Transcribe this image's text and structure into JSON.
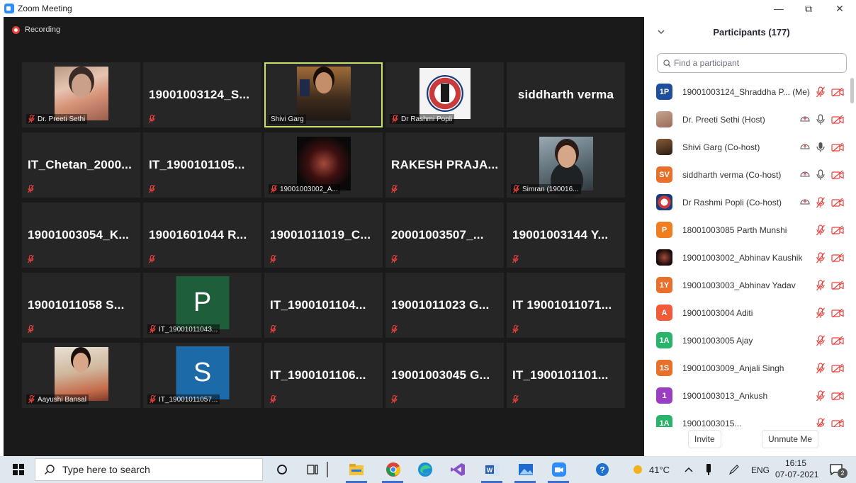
{
  "window": {
    "title": "Zoom Meeting",
    "minimize": "—",
    "restore": "⧉",
    "close": "✕"
  },
  "recording": {
    "label": "Recording"
  },
  "tiles": [
    {
      "type": "photo",
      "photo": "preeti",
      "label": "Dr. Preeti Sethi"
    },
    {
      "type": "name",
      "name": "19001003124_S...",
      "label": ""
    },
    {
      "type": "photo",
      "photo": "shivi",
      "label": "Shivi Garg",
      "active": true,
      "nomic": true
    },
    {
      "type": "photo",
      "photo": "logo",
      "label": "Dr Rashmi Popli"
    },
    {
      "type": "name",
      "name": "siddharth verma",
      "center": true,
      "nomic": true,
      "label": ""
    },
    {
      "type": "name",
      "name": "IT_Chetan_2000...",
      "label": ""
    },
    {
      "type": "name",
      "name": "IT_1900101105...",
      "label": ""
    },
    {
      "type": "photo",
      "photo": "abhinav",
      "label": "19001003002_A..."
    },
    {
      "type": "name",
      "name": "RAKESH PRAJA...",
      "label": ""
    },
    {
      "type": "photo",
      "photo": "simran",
      "label": "Simran (190016..."
    },
    {
      "type": "name",
      "name": "19001003054_K...",
      "label": ""
    },
    {
      "type": "name",
      "name": "19001601044 R...",
      "label": ""
    },
    {
      "type": "name",
      "name": "19001011019_C...",
      "label": ""
    },
    {
      "type": "name",
      "name": "20001003507_...",
      "label": ""
    },
    {
      "type": "name",
      "name": "19001003144 Y...",
      "label": ""
    },
    {
      "type": "name",
      "name": "19001011058 S...",
      "label": ""
    },
    {
      "type": "avatar",
      "letter": "P",
      "color": "#1e5e3a",
      "label": "IT_19001011043..."
    },
    {
      "type": "name",
      "name": "IT_1900101104...",
      "label": ""
    },
    {
      "type": "name",
      "name": "19001011023 G...",
      "label": ""
    },
    {
      "type": "name",
      "name": "IT 19001011071...",
      "label": ""
    },
    {
      "type": "photo",
      "photo": "aayushi",
      "label": "Aayushi Bansal"
    },
    {
      "type": "avatar",
      "letter": "S",
      "color": "#1c6aa8",
      "label": "IT_19001011057..."
    },
    {
      "type": "name",
      "name": "IT_1900101106...",
      "label": ""
    },
    {
      "type": "name",
      "name": "19001003045 G...",
      "label": ""
    },
    {
      "type": "name",
      "name": "IT_1900101101...",
      "label": ""
    }
  ],
  "panel": {
    "title": "Participants (177)",
    "collapse_icon": "chevron-down-icon",
    "search_placeholder": "Find a participant",
    "participants": [
      {
        "initials": "1P",
        "color": "#1d4f9c",
        "name": "19001003124_Shraddha P... (Me)",
        "audio": "muted",
        "video": "off"
      },
      {
        "initials": "",
        "img": "img1",
        "name": "Dr. Preeti Sethi (Host)",
        "share": true,
        "audio": "on",
        "video": "off"
      },
      {
        "initials": "",
        "img": "img2",
        "name": "Shivi Garg (Co-host)",
        "share": true,
        "audio": "active",
        "video": "off"
      },
      {
        "initials": "SV",
        "color": "#e8702a",
        "name": "siddharth verma (Co-host)",
        "share": true,
        "audio": "on",
        "video": "off"
      },
      {
        "initials": "",
        "img": "img3",
        "name": "Dr Rashmi Popli (Co-host)",
        "share": true,
        "audio": "muted",
        "video": "off"
      },
      {
        "initials": "P",
        "color": "#f07e20",
        "name": "18001003085 Parth Munshi",
        "audio": "muted",
        "video": "off"
      },
      {
        "initials": "",
        "img": "img4",
        "name": "19001003002_Abhinav Kaushik",
        "audio": "muted",
        "video": "off"
      },
      {
        "initials": "1Y",
        "color": "#e8702a",
        "name": "19001003003_Abhinav Yadav",
        "audio": "muted",
        "video": "off"
      },
      {
        "initials": "A",
        "color": "#f25b3a",
        "name": "19001003004 Aditi",
        "audio": "muted",
        "video": "off"
      },
      {
        "initials": "1A",
        "color": "#29b36b",
        "name": "19001003005 Ajay",
        "audio": "muted",
        "video": "off"
      },
      {
        "initials": "1S",
        "color": "#e8702a",
        "name": "19001003009_Anjali Singh",
        "audio": "muted",
        "video": "off"
      },
      {
        "initials": "1",
        "color": "#9b3fc2",
        "name": "19001003013_Ankush",
        "audio": "muted",
        "video": "off"
      },
      {
        "initials": "1A",
        "color": "#29b36b",
        "name": "19001003015...",
        "audio": "muted",
        "video": "off"
      }
    ],
    "invite_label": "Invite",
    "unmute_label": "Unmute Me"
  },
  "taskbar": {
    "search_text": "Type here to search",
    "temperature": "41°C",
    "language": "ENG",
    "time": "16:15",
    "date": "07-07-2021",
    "notification_count": "2",
    "apps": [
      "cortana-icon",
      "task-view-icon",
      "file-explorer-icon",
      "chrome-icon",
      "edge-icon",
      "visual-studio-icon",
      "word-icon",
      "photos-icon",
      "zoom-icon",
      "help-icon"
    ]
  },
  "colors": {
    "accent_active": "#c7e26a",
    "mute_red": "#e8413c",
    "zoom_blue": "#2d8cff"
  }
}
